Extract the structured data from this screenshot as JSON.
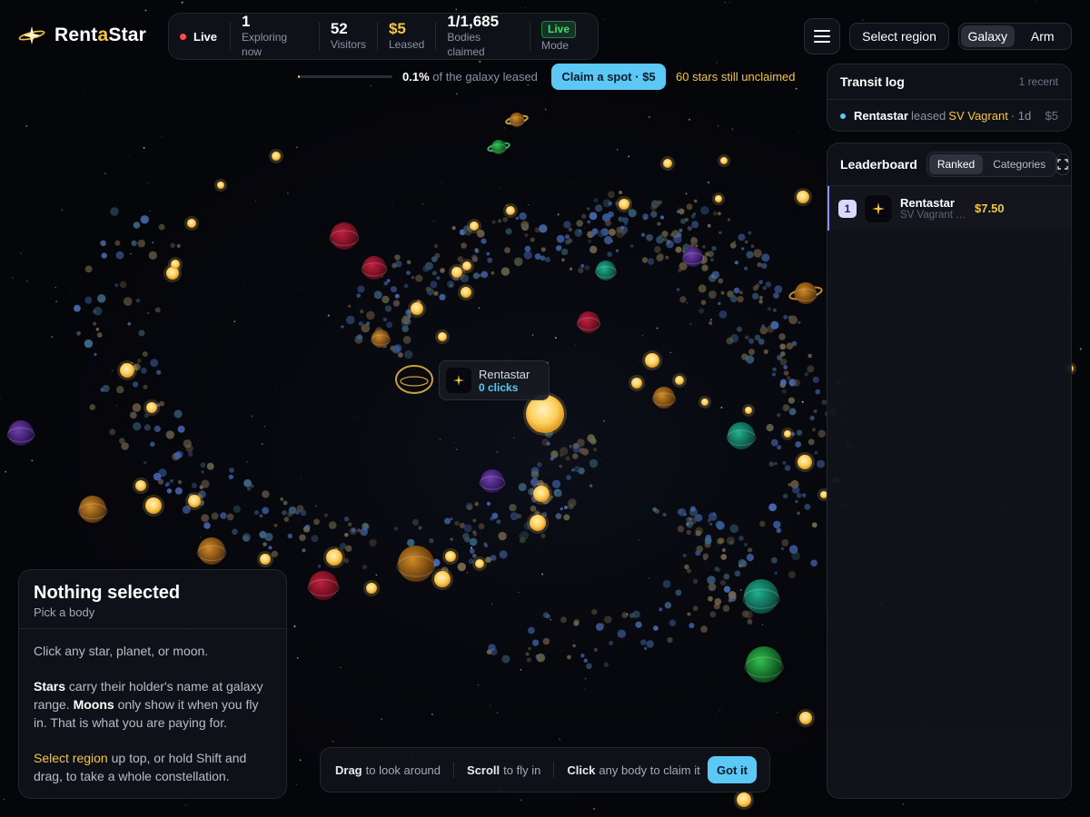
{
  "app": {
    "logo_pre": "Rent",
    "logo_accent": "a",
    "logo_post": "Star",
    "accent_color": "#f5c542",
    "link_color": "#5cc8f5"
  },
  "stats": {
    "live_label": "Live",
    "items": [
      {
        "value": "1",
        "label": "Exploring now"
      },
      {
        "value": "52",
        "label": "Visitors"
      },
      {
        "value": "$5",
        "label": "Leased"
      },
      {
        "value": "1/1,685",
        "label": "Bodies claimed"
      }
    ],
    "mode_value": "Live",
    "mode_label": "Mode"
  },
  "progress": {
    "fraction": 0.001,
    "percent_text": "0.1%",
    "suffix": "of the galaxy leased",
    "claim_label": "Claim a spot · $5",
    "unclaimed_text": "60 stars still unclaimed"
  },
  "toolbar": {
    "menu_icon": "hamburger-icon",
    "region_label": "Select region",
    "view_options": [
      "Galaxy",
      "Arm"
    ],
    "active_view": "Galaxy"
  },
  "transit_log": {
    "title": "Transit log",
    "count": "1 recent",
    "entries": [
      {
        "who": "Rentastar",
        "verb": "leased",
        "what": "SV Vagrant",
        "ago": "· 1d",
        "price": "$5"
      }
    ]
  },
  "leaderboard": {
    "title": "Leaderboard",
    "tabs": [
      "Ranked",
      "Categories"
    ],
    "active_tab": "Ranked",
    "rows": [
      {
        "rank": "1",
        "name": "Rentastar",
        "sub": "SV Vagrant · Nova",
        "amount": "$7.50"
      }
    ]
  },
  "tooltip": {
    "name": "Rentastar",
    "clicks": "0 clicks"
  },
  "selection": {
    "title": "Nothing selected",
    "subtitle": "Pick a body",
    "line1": "Click any star, planet, or moon.",
    "stars_word": "Stars",
    "stars_text": " carry their holder's name at galaxy range. ",
    "moons_word": "Moons",
    "moons_text": " only show it when you fly in. That is what you are paying for.",
    "region_word": "Select region",
    "region_text": " up top, or hold Shift and drag, to take a whole constellation."
  },
  "hints": {
    "items": [
      {
        "key": "Drag",
        "text": "to look around"
      },
      {
        "key": "Scroll",
        "text": "to fly in"
      },
      {
        "key": "Click",
        "text": "any body to claim it"
      }
    ],
    "dismiss_label": "Got it"
  }
}
